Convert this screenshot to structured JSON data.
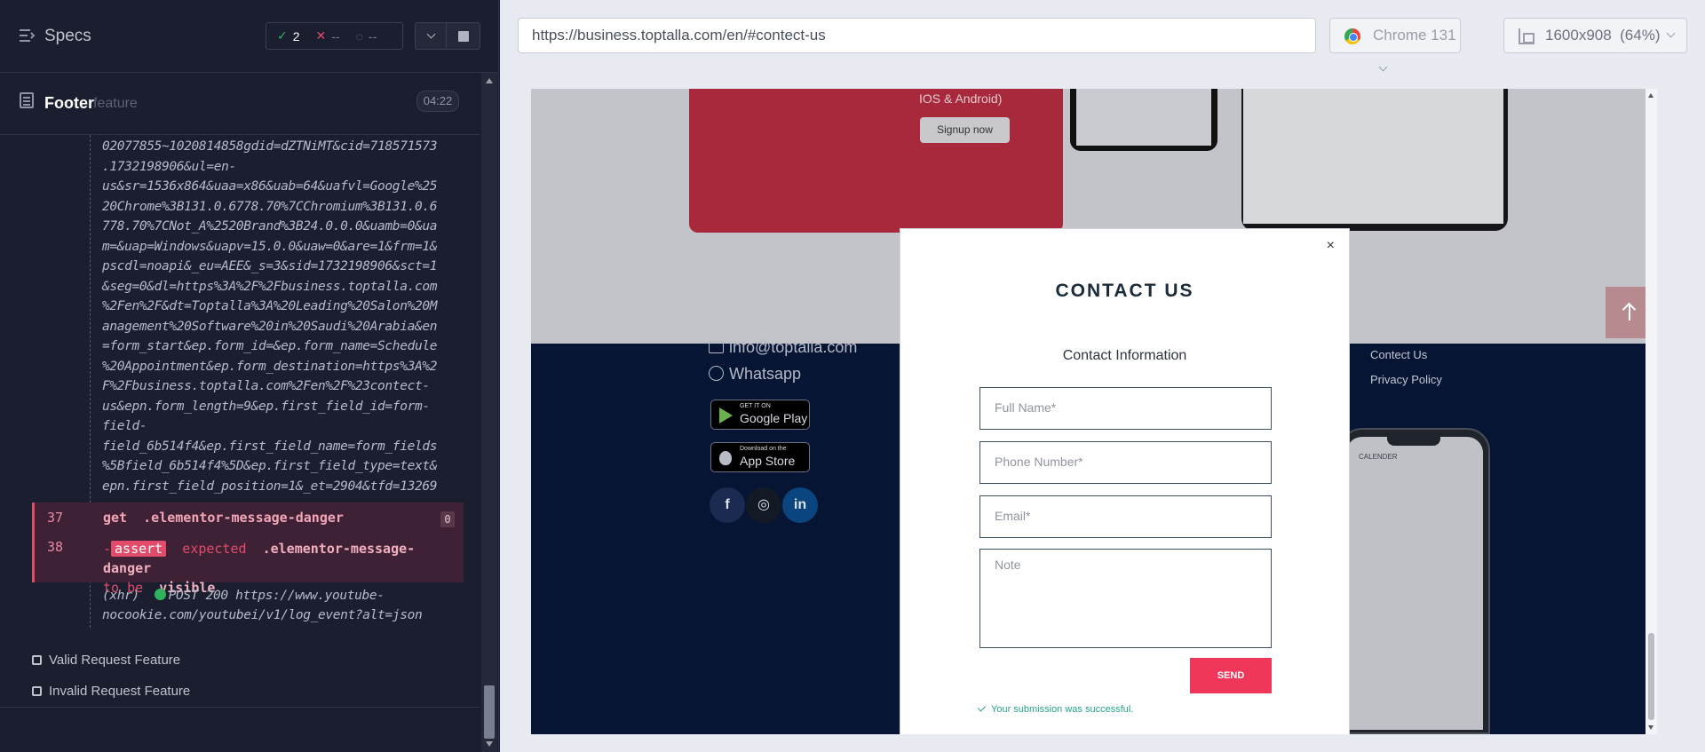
{
  "runner": {
    "specs_title": "Specs",
    "stats": {
      "passed": "2",
      "failed": "--",
      "pending": "--"
    },
    "feature_name": "Footer",
    "feature_type": "feature",
    "duration": "04:22",
    "log_lines": [
      "02077855~1020814858gdid=dZTNiMT&cid=718571573",
      ".1732198906&ul=en-",
      "us&sr=1536x864&uaa=x86&uab=64&uafvl=Google%25",
      "20Chrome%3B131.0.6778.70%7CChromium%3B131.0.6",
      "778.70%7CNot_A%2520Brand%3B24.0.0.0&uamb=0&ua",
      "m=&uap=Windows&uapv=15.0.0&uaw=0&are=1&frm=1&",
      "pscdl=noapi&_eu=AEE&_s=3&sid=1732198906&sct=1",
      "&seg=0&dl=https%3A%2F%2Fbusiness.toptalla.com",
      "%2Fen%2F&dt=Toptalla%3A%20Leading%20Salon%20M",
      "anagement%20Software%20in%20Saudi%20Arabia&en",
      "=form_start&ep.form_id=&ep.form_name=Schedule",
      "%20Appointment&ep.form_destination=https%3A%2",
      "F%2Fbusiness.toptalla.com%2Fen%2F%23contect-",
      "us&epn.form_length=9&ep.first_field_id=form-",
      "field-",
      "field_6b514f4&ep.first_field_name=form_fields",
      "%5Bfield_6b514f4%5D&ep.first_field_type=text&",
      "epn.first_field_position=1&_et=2904&tfd=13269"
    ],
    "cmd37": {
      "num": "37",
      "name": "get",
      "selector": ".elementor-message-danger",
      "count": "0"
    },
    "cmd38": {
      "num": "38",
      "tag": "assert",
      "text_a": "expected",
      "selector": ".elementor-message-danger",
      "text_b": "to be",
      "keyword": "visible"
    },
    "xhr": {
      "label": "(xhr)",
      "line1": "POST 200 https://www.youtube-",
      "line2": "nocookie.com/youtubei/v1/log_event?alt=json"
    },
    "features": [
      "Valid Request Feature",
      "Invalid Request Feature"
    ]
  },
  "browser": {
    "url": "https://business.toptalla.com/en/#contect-us",
    "name": "Chrome 131",
    "viewport": "1600x908",
    "zoom": "(64%)"
  },
  "page": {
    "ios_text": "IOS & Android)",
    "signup": "Signup now",
    "email": "info@toptalla.com",
    "whatsapp": "Whatsapp",
    "google_play_small": "GET IT ON",
    "google_play": "Google Play",
    "app_store_small": "Download on the",
    "app_store": "App Store",
    "links": [
      "Contect Us",
      "Privacy Policy"
    ],
    "calendar": "CALENDER",
    "social": {
      "facebook": "f",
      "instagram": "◎",
      "linkedin": "in"
    }
  },
  "modal": {
    "close": "×",
    "title": "CONTACT US",
    "subtitle": "Contact Information",
    "placeholders": {
      "name": "Full Name*",
      "phone": "Phone Number*",
      "email": "Email*",
      "note": "Note"
    },
    "send": "SEND",
    "success": "Your submission was successful."
  }
}
